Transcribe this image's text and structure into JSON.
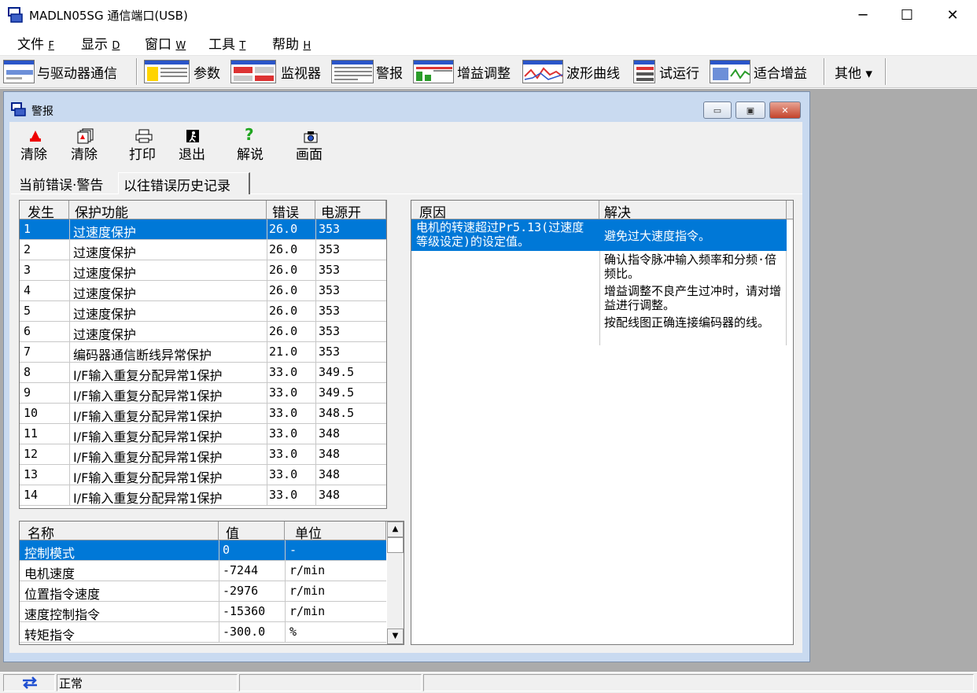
{
  "window": {
    "title": "MADLN05SG  通信端口(USB)",
    "minimize": "─",
    "maximize": "☐",
    "close": "✕"
  },
  "menu": [
    {
      "label": "文件",
      "key": "F"
    },
    {
      "label": "显示",
      "key": "D"
    },
    {
      "label": "窗口",
      "key": "W"
    },
    {
      "label": "工具",
      "key": "T"
    },
    {
      "label": "帮助",
      "key": "H"
    }
  ],
  "toolbar": {
    "comm": "与驱动器通信",
    "params": "参数",
    "monitor": "监视器",
    "alarm": "警报",
    "gain": "增益调整",
    "wave": "波形曲线",
    "trial": "试运行",
    "fit": "适合增益",
    "other": "其他 ▾"
  },
  "child": {
    "title": "警报",
    "min": "▭",
    "max": "▣",
    "close": "✕",
    "tools": {
      "clear1": "清除",
      "clear2": "清除",
      "print": "打印",
      "exit": "退出",
      "help": "解说",
      "screen": "画面"
    },
    "tabs": [
      "当前错误·警告",
      "以往错误历史记录"
    ]
  },
  "history": {
    "headers": [
      "发生",
      "保护功能",
      "错误",
      "电源开"
    ],
    "rows": [
      [
        "1",
        "过速度保护",
        "26.0",
        "353"
      ],
      [
        "2",
        "过速度保护",
        "26.0",
        "353"
      ],
      [
        "3",
        "过速度保护",
        "26.0",
        "353"
      ],
      [
        "4",
        "过速度保护",
        "26.0",
        "353"
      ],
      [
        "5",
        "过速度保护",
        "26.0",
        "353"
      ],
      [
        "6",
        "过速度保护",
        "26.0",
        "353"
      ],
      [
        "7",
        "编码器通信断线异常保护",
        "21.0",
        "353"
      ],
      [
        "8",
        "I/F输入重复分配异常1保护",
        "33.0",
        "349.5"
      ],
      [
        "9",
        "I/F输入重复分配异常1保护",
        "33.0",
        "349.5"
      ],
      [
        "10",
        "I/F输入重复分配异常1保护",
        "33.0",
        "348.5"
      ],
      [
        "11",
        "I/F输入重复分配异常1保护",
        "33.0",
        "348"
      ],
      [
        "12",
        "I/F输入重复分配异常1保护",
        "33.0",
        "348"
      ],
      [
        "13",
        "I/F输入重复分配异常1保护",
        "33.0",
        "348"
      ],
      [
        "14",
        "I/F输入重复分配异常1保护",
        "33.0",
        "348"
      ]
    ]
  },
  "monitor": {
    "headers": [
      "名称",
      "值",
      "单位"
    ],
    "rows": [
      [
        "控制模式",
        "0",
        "-"
      ],
      [
        "电机速度",
        "-7244",
        "r/min"
      ],
      [
        "位置指令速度",
        "-2976",
        "r/min"
      ],
      [
        "速度控制指令",
        "-15360",
        "r/min"
      ],
      [
        "转矩指令",
        "-300.0",
        "%"
      ]
    ]
  },
  "cause": {
    "headers": [
      "原因",
      "解决"
    ],
    "cause_text": "电机的转速超过Pr5.13(过速度等级设定)的设定值。",
    "solutions": [
      "避免过大速度指令。",
      "确认指令脉冲输入频率和分频·倍频比。",
      "增益调整不良产生过冲时，请对增益进行调整。",
      "按配线图正确连接编码器的线。"
    ]
  },
  "status": {
    "text": "正常"
  },
  "colors": {
    "selection": "#0078d7",
    "mdi_bg": "#ababab"
  }
}
